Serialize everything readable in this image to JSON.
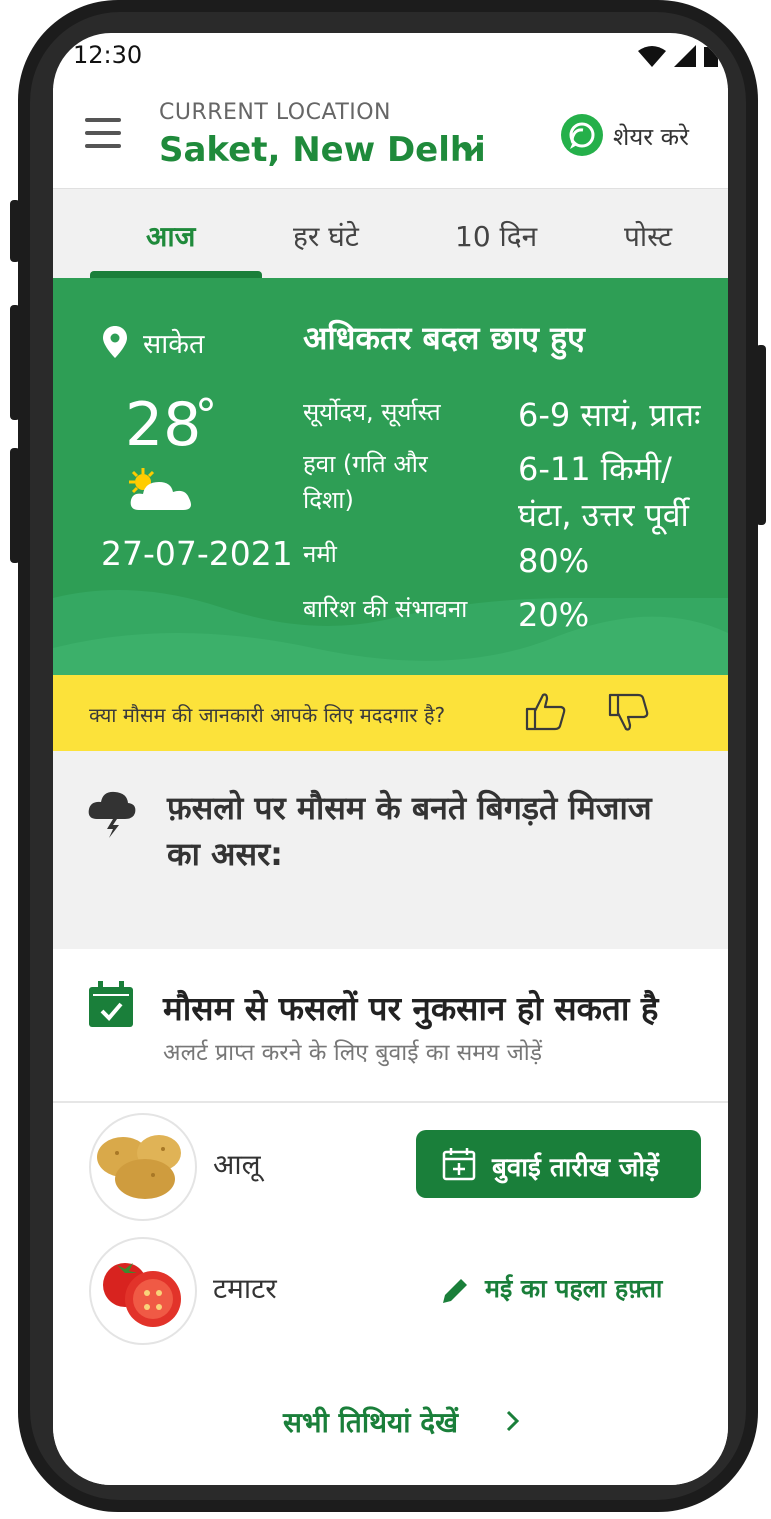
{
  "status_bar": {
    "time": "12:30"
  },
  "header": {
    "location_label": "CURRENT LOCATION",
    "location_name": "Saket, New Delhi",
    "share_label": "शेयर करे"
  },
  "tabs": [
    {
      "label": "आज",
      "active": true
    },
    {
      "label": "हर घंटे",
      "active": false
    },
    {
      "label": "10 दिन",
      "active": false
    },
    {
      "label": "पोस्ट",
      "active": false
    }
  ],
  "weather": {
    "place": "साकेत",
    "temperature": "28",
    "degree_symbol": "°",
    "date": "27-07-2021",
    "condition": "अधिकतर बदल छाए हुए",
    "rows": [
      {
        "key": "सूर्योदय, सूर्यास्त",
        "value": "6-9 सायं, प्रातः"
      },
      {
        "key_line1": "हवा (गति और",
        "key_line2": "दिशा)",
        "value_line1": "6-11 किमी/",
        "value_line2": "घंटा, उत्तर पूर्वी"
      },
      {
        "key": "नमी",
        "value": "80%"
      },
      {
        "key": "बारिश की संभावना",
        "value": "20%"
      }
    ],
    "colors": {
      "background": "#2e9e55",
      "wave": "#35a862"
    }
  },
  "feedback": {
    "question": "क्या मौसम की जानकारी आपके लिए मददगार है?",
    "like_icon": "thumbs-up-icon",
    "dislike_icon": "thumbs-down-icon"
  },
  "impact": {
    "title_line1": "फ़सलो पर मौसम के बनते बिगड़ते मिजाज",
    "title_line2": "का असर:"
  },
  "alert": {
    "title": "मौसम से फसलों पर नुकसान हो सकता है",
    "subtitle": "अलर्ट प्राप्त करने के लिए बुवाई का समय जोड़ें"
  },
  "crops": [
    {
      "name": "आलू",
      "action": "बुवाई तारीख जोड़ें",
      "action_type": "button"
    },
    {
      "name": "टमाटर",
      "action": "मई का पहला हफ़्ता",
      "action_type": "edit"
    }
  ],
  "footer": {
    "view_all": "सभी तिथियां देखें"
  },
  "accent_color": "#1a7f3a",
  "feedback_color": "#fce23a"
}
